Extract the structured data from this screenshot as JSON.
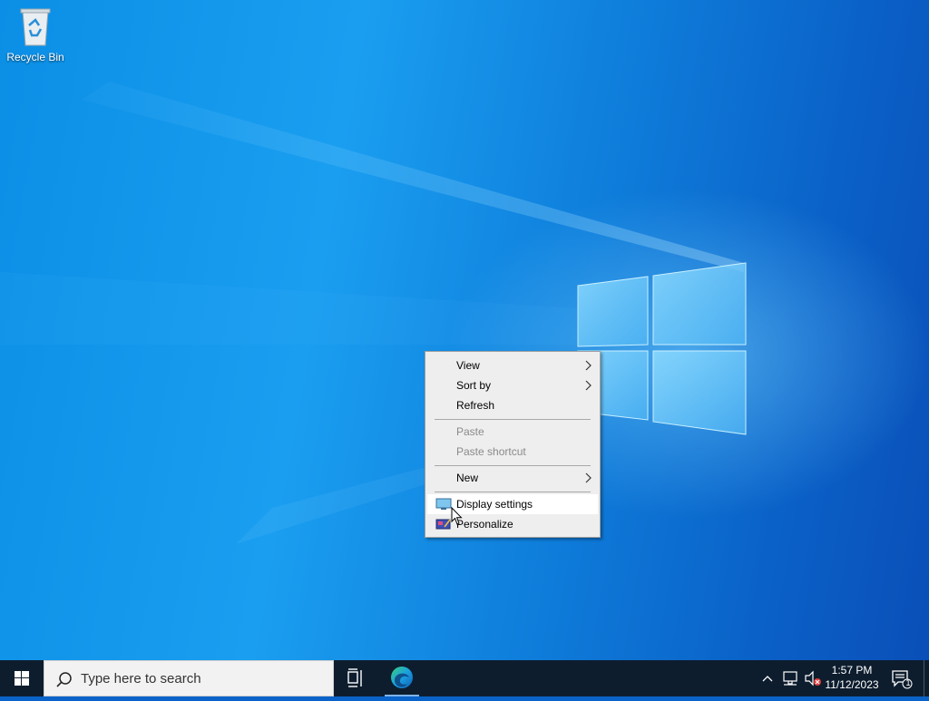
{
  "desktop": {
    "icons": [
      {
        "label": "Recycle Bin",
        "icon": "recycle-bin-icon"
      }
    ]
  },
  "context_menu": {
    "items": [
      {
        "label": "View",
        "submenu": true,
        "enabled": true
      },
      {
        "label": "Sort by",
        "submenu": true,
        "enabled": true
      },
      {
        "label": "Refresh",
        "submenu": false,
        "enabled": true
      },
      {
        "label": "Paste",
        "submenu": false,
        "enabled": false
      },
      {
        "label": "Paste shortcut",
        "submenu": false,
        "enabled": false
      },
      {
        "label": "New",
        "submenu": true,
        "enabled": true
      },
      {
        "label": "Display settings",
        "submenu": false,
        "enabled": true,
        "icon": "display-settings-icon",
        "hovered": true
      },
      {
        "label": "Personalize",
        "submenu": false,
        "enabled": true,
        "icon": "personalize-icon"
      }
    ]
  },
  "taskbar": {
    "search_placeholder": "Type here to search",
    "pinned": [
      "task-view-icon",
      "edge-icon"
    ],
    "clock": {
      "time": "1:57 PM",
      "date": "11/12/2023"
    },
    "notification_count": "1"
  },
  "colors": {
    "wallpaper": "#0a63c8",
    "taskbar": "#0d1d2e",
    "menu_bg": "#eeeeee",
    "menu_hover": "#ffffff",
    "disabled_text": "#8a8a8a"
  }
}
